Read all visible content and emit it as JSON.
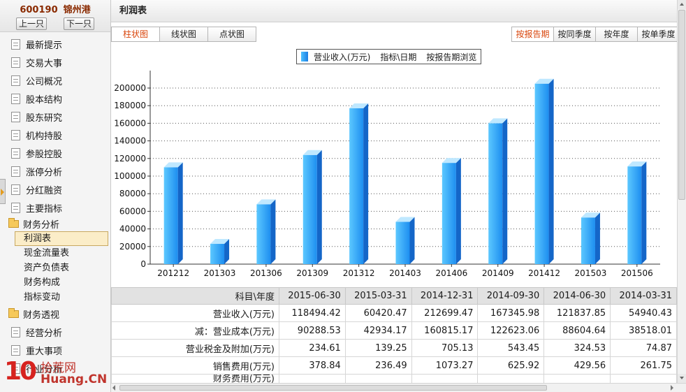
{
  "stock": {
    "code": "600190",
    "name": "锦州港",
    "prev_label": "上一只",
    "next_label": "下一只"
  },
  "menu": [
    {
      "label": "最新提示"
    },
    {
      "label": "交易大事"
    },
    {
      "label": "公司概况"
    },
    {
      "label": "股本结构"
    },
    {
      "label": "股东研究"
    },
    {
      "label": "机构持股"
    },
    {
      "label": "参股控股"
    },
    {
      "label": "涨停分析"
    },
    {
      "label": "分红融资"
    },
    {
      "label": "主要指标"
    }
  ],
  "finance_folder": {
    "label": "财务分析",
    "items": [
      "利润表",
      "现金流量表",
      "资产负债表",
      "财务构成",
      "指标变动"
    ],
    "active": "利润表"
  },
  "menu_after": [
    {
      "label": "财务透视",
      "type": "folder"
    },
    {
      "label": "经营分析",
      "type": "doc"
    },
    {
      "label": "重大事项",
      "type": "doc"
    },
    {
      "label": "行业分析",
      "type": "doc"
    }
  ],
  "watermark": {
    "ten": "10",
    "cn": "拾荒网",
    "en": "Huang.CN"
  },
  "panel": {
    "title": "利润表"
  },
  "chart_types": [
    "柱状图",
    "线状图",
    "点状图"
  ],
  "chart_type_active": "柱状图",
  "periods": [
    "按报告期",
    "按同季度",
    "按年度",
    "按单季度"
  ],
  "period_active": "按报告期",
  "legend": {
    "series": "营业收入(万元)",
    "axis_note": "指标\\日期",
    "browse": "按报告期浏览"
  },
  "colors": {
    "bar_front": "#1d8ef0",
    "bar_light": "#5cc8ff",
    "bar_top": "#bfe8ff",
    "bar_side": "#1466c8",
    "accent": "#d9460c"
  },
  "chart_data": {
    "type": "bar",
    "categories": [
      "201212",
      "201303",
      "201306",
      "201309",
      "201312",
      "201403",
      "201406",
      "201409",
      "201412",
      "201503",
      "201506"
    ],
    "series": [
      {
        "name": "营业收入(万元)",
        "values": [
          110000,
          23000,
          68000,
          124000,
          177000,
          48000,
          115000,
          160000,
          205000,
          53000,
          111000
        ]
      }
    ],
    "ylim": [
      0,
      200000
    ],
    "yticks": [
      "0",
      "20000",
      "40000",
      "60000",
      "80000",
      "100000",
      "120000",
      "140000",
      "160000",
      "180000",
      "200000"
    ],
    "grid": true
  },
  "table": {
    "headers": [
      "科目\\年度",
      "2015-06-30",
      "2015-03-31",
      "2014-12-31",
      "2014-09-30",
      "2014-06-30",
      "2014-03-31"
    ],
    "rows": [
      [
        "营业收入(万元)",
        "118494.42",
        "60420.47",
        "212699.47",
        "167345.98",
        "121837.85",
        "54940.43"
      ],
      [
        "减：营业成本(万元)",
        "90288.53",
        "42934.17",
        "160815.17",
        "122623.06",
        "88604.64",
        "38518.01"
      ],
      [
        "营业税金及附加(万元)",
        "234.61",
        "139.25",
        "705.13",
        "543.45",
        "324.53",
        "74.87"
      ],
      [
        "销售费用(万元)",
        "378.84",
        "236.49",
        "1073.27",
        "625.92",
        "429.56",
        "261.75"
      ]
    ],
    "clipped_row_label": "财务费用(万元)"
  }
}
